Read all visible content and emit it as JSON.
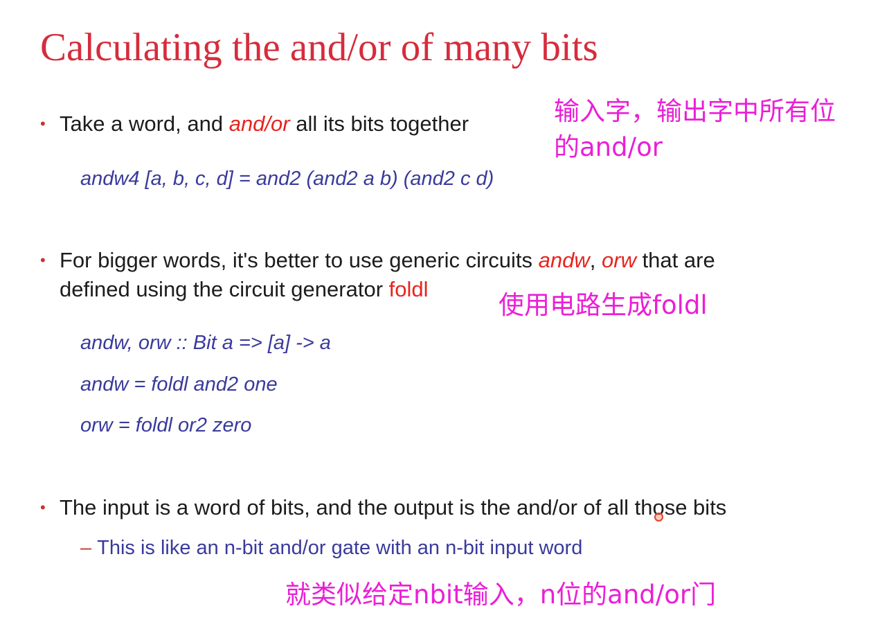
{
  "slide": {
    "title": "Calculating the and/or of many bits",
    "bullet_marker": "•",
    "bullet1": {
      "pre": "Take a word, and ",
      "em": "and/or",
      "post": " all its bits together"
    },
    "code1": "andw4 [a, b, c, d] = and2 (and2 a b) (and2 c d)",
    "bullet2": {
      "line1_pre": "For bigger words, it's better to use generic circuits ",
      "em1": "andw",
      "sep": ", ",
      "em2": "orw",
      "line1_post": " that are",
      "line2_pre": "defined using the circuit generator ",
      "em3": "foldl"
    },
    "code2": [
      "andw, orw :: Bit a => [a] -> a",
      "andw = foldl and2 one",
      "orw = foldl or2 zero"
    ],
    "bullet3": "The input is a word of bits, and the output is the and/or of all those bits",
    "sub_dash": "–",
    "sub3": "This is like an n-bit and/or gate with an n-bit input word"
  },
  "annotations": {
    "note1_line1": "输入字，输出字中所有位",
    "note1_line2": "的and/or",
    "note2": "使用电路生成foldl",
    "note3": "就类似给定nbit输入，n位的and/or门"
  },
  "colors": {
    "title": "#d62c3c",
    "emphasis": "#e8231d",
    "code": "#3a3a9c",
    "annotation": "#ea1fd6"
  }
}
